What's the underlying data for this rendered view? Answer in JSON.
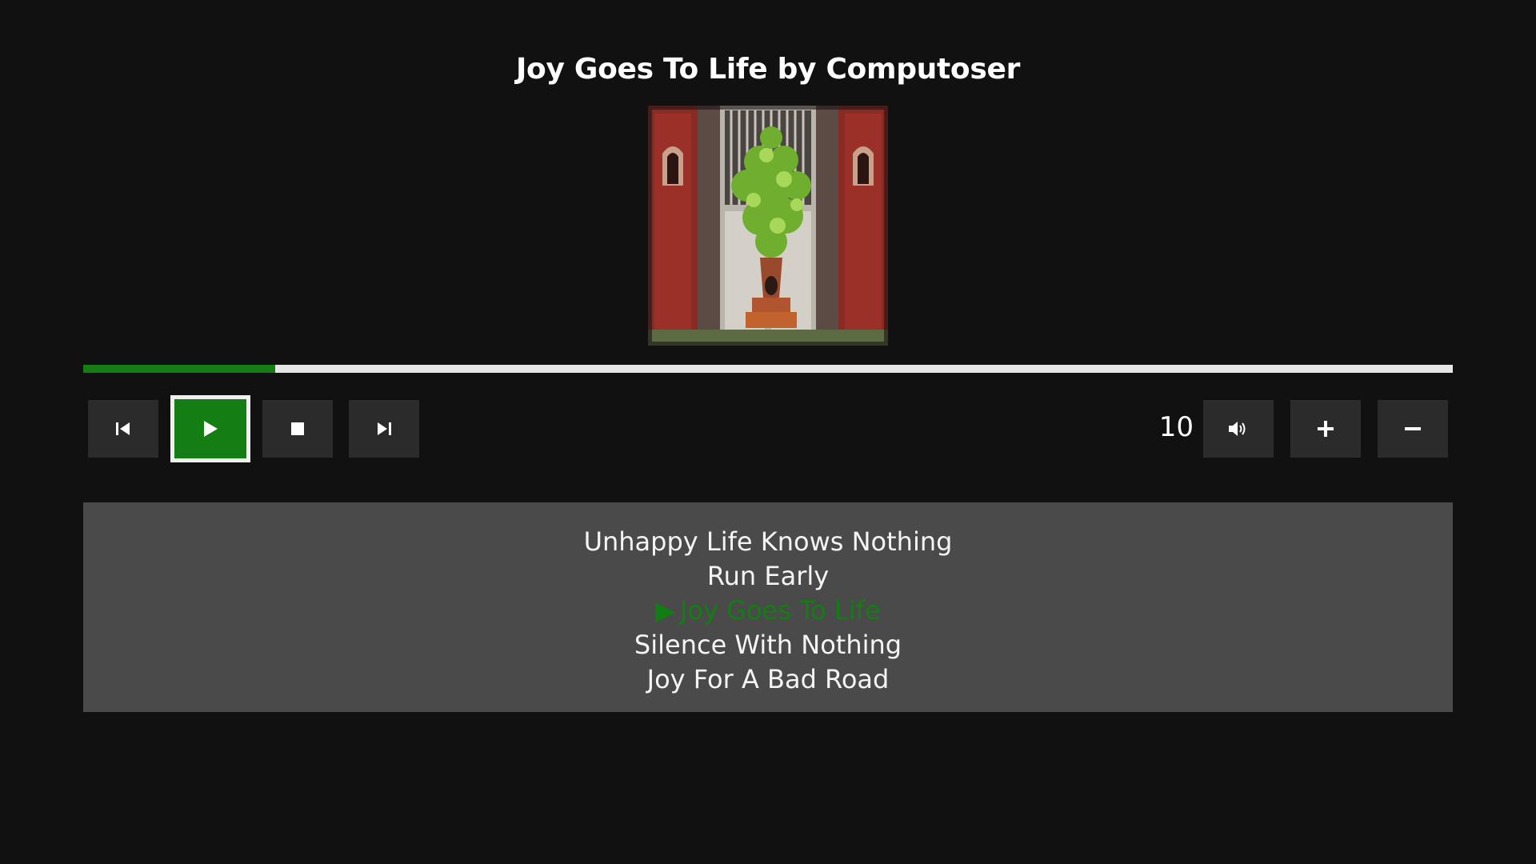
{
  "player": {
    "title": "Joy Goes To Life by Computoser",
    "progress_fraction": 0.14,
    "volume": "10"
  },
  "controls": {
    "previous_icon": "skip-previous-icon",
    "play_icon": "play-icon",
    "stop_icon": "stop-icon",
    "next_icon": "skip-next-icon",
    "volume_icon": "speaker-icon",
    "volume_up_icon": "plus-icon",
    "volume_down_icon": "minus-icon"
  },
  "playlist": {
    "tracks": [
      {
        "label": "Unhappy Life Knows Nothing",
        "active": false
      },
      {
        "label": "Run Early",
        "active": false
      },
      {
        "label": "Joy Goes To Life",
        "active": true
      },
      {
        "label": "Silence With Nothing",
        "active": false
      },
      {
        "label": "Joy For A Bad Road",
        "active": false
      }
    ],
    "active_marker": "▶"
  },
  "colors": {
    "accent": "#147d14",
    "background": "#111111",
    "panel": "#4a4a4a",
    "button": "#2b2b2b"
  }
}
